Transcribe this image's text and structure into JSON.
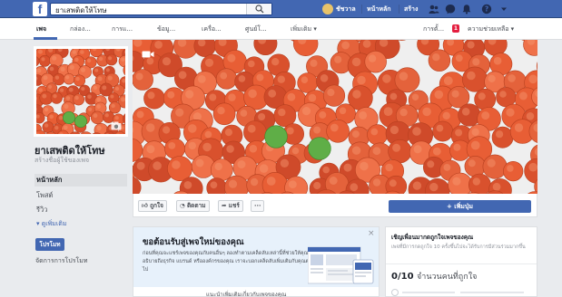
{
  "topbar": {
    "search_value": "ยาเสพติดให้โทษ",
    "user_name": "ชัชวาล",
    "home_label": "หน้าหลัก",
    "create_label": "สร้าง",
    "brand_color": "#4267b2"
  },
  "pagebar": {
    "tabs": [
      "เพจ",
      "กล่อง...",
      "การแ...",
      "ข้อมู...",
      "เครื่อ...",
      "ศูนย์โ...",
      "เพิ่มเติม ▾"
    ],
    "settings_label": "การตั้...",
    "notif_count": "1",
    "help_label": "ความช่วยเหลือ ▾"
  },
  "sidebar": {
    "page_name": "ยาเสพติดให้โทษ",
    "handle_label": "สร้างชื่อผู้ใช้ของเพจ",
    "nav": [
      "หน้าหลัก",
      "โพสต์",
      "รีวิว"
    ],
    "more_label": "▾ ดูเพิ่มเติม",
    "promote_label": "โปรโมท",
    "manage_promotions_label": "จัดการการโปรโมท"
  },
  "action_bar": {
    "like_label": "ถูกใจ",
    "follow_label": "ติดตาม",
    "share_label": "แชร์",
    "more_label": "···",
    "add_button_label": "+ เพิ่มปุ่ม"
  },
  "welcome": {
    "title": "ขอต้อนรับสู่เพจใหม่ของคุณ",
    "body": "ก่อนที่คุณจะแชร์เพจของคุณกับคนอื่นๆ ลองทำตามเคล็ดลับเหล่านี้ที่ช่วยให้คุณอธิบายถึงธุรกิจ แบรนด์ หรือองค์กรของคุณ เราจะบอกเคล็ดลับเพิ่มเติมกับคุณต่อไป",
    "close_label": "×",
    "bottom_label": "แนะนำเพิ่มเติมเกี่ยวกับเพจของคุณ"
  },
  "invite": {
    "title": "เชิญเพื่อนมากดถูกใจเพจของคุณ",
    "subtitle": "เพจที่มีการกดถูกใจ 10 ครั้งขึ้นไปจะได้รับการมีส่วนร่วมมากขึ้น",
    "count": "0/10",
    "count_label": "จำนวนคนที่ถูกใจ"
  }
}
